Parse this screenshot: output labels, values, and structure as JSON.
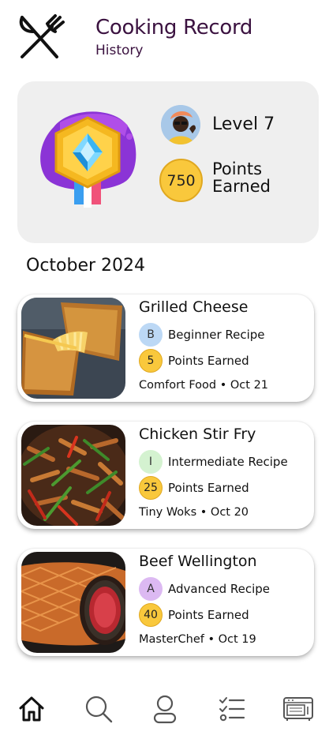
{
  "header": {
    "title": "Cooking Record",
    "subtitle": "History",
    "logo_icon": "fork-knife-crossed-icon"
  },
  "stats": {
    "badge_icon": "diamond-medal-badge-icon",
    "level": "Level 7",
    "points": "750",
    "points_label": "Points Earned"
  },
  "month": "October 2024",
  "recipes": [
    {
      "name": "Grilled Cheese",
      "level_letter": "B",
      "level_label": "Beginner Recipe",
      "level_color": "#bcd8f5",
      "points": "5",
      "points_label": "Points Earned",
      "meta": "Comfort Food • Oct 21"
    },
    {
      "name": "Chicken Stir Fry",
      "level_letter": "I",
      "level_label": "Intermediate Recipe",
      "level_color": "#d4f2d0",
      "points": "25",
      "points_label": "Points Earned",
      "meta": "Tiny Woks • Oct 20"
    },
    {
      "name": "Beef Wellington",
      "level_letter": "A",
      "level_label": "Advanced Recipe",
      "level_color": "#dcb9f2",
      "points": "40",
      "points_label": "Points Earned",
      "meta": "MasterChef  • Oct 19"
    }
  ],
  "nav": {
    "items": [
      "home-icon",
      "search-icon",
      "profile-icon",
      "checklist-icon",
      "oven-icon"
    ],
    "active": "home-icon"
  },
  "colors": {
    "title": "#3b1240",
    "card_bg": "#efefef",
    "points_gold": "#f9c83c"
  }
}
